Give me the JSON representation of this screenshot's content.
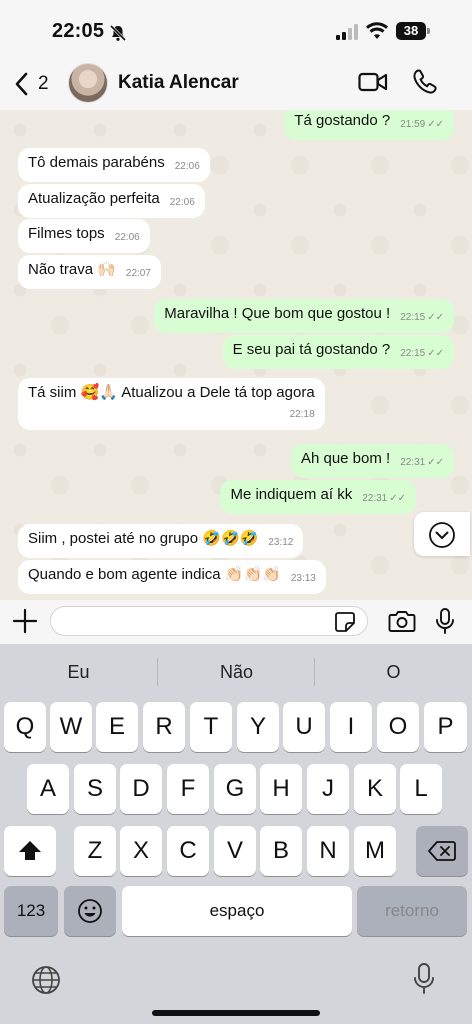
{
  "status_bar": {
    "time": "22:05",
    "battery": "38"
  },
  "header": {
    "back_count": "2",
    "contact_name": "Katia Alencar"
  },
  "messages": [
    {
      "dir": "out",
      "text": "Tá gostando ?",
      "time": "21:59"
    },
    {
      "dir": "in",
      "text": "Tô demais parabéns",
      "time": "22:06"
    },
    {
      "dir": "in",
      "text": "Atualização perfeita",
      "time": "22:06"
    },
    {
      "dir": "in",
      "text": "Filmes tops",
      "time": "22:06"
    },
    {
      "dir": "in",
      "text": "Não trava 🙌🏻",
      "time": "22:07"
    },
    {
      "dir": "out",
      "text": "Maravilha ! Que bom que gostou !",
      "time": "22:15"
    },
    {
      "dir": "out",
      "text": "E seu pai tá gostando ?",
      "time": "22:15"
    },
    {
      "dir": "in",
      "text": "Tá siim 🥰🙏🏻 Atualizou a Dele tá top agora",
      "time": "22:18"
    },
    {
      "dir": "out",
      "text": "Ah que bom !",
      "time": "22:31"
    },
    {
      "dir": "out",
      "text": "Me indiquem aí kk",
      "time": "22:31"
    },
    {
      "dir": "in",
      "text": "Siim , postei até no grupo 🤣🤣🤣",
      "time": "23:12"
    },
    {
      "dir": "in",
      "text": "Quando e bom agente indica 👏🏻👏🏻👏🏻",
      "time": "23:13"
    }
  ],
  "composer": {
    "placeholder": ""
  },
  "keyboard": {
    "suggestions": [
      "Eu",
      "Não",
      "O"
    ],
    "row1": [
      "Q",
      "W",
      "E",
      "R",
      "T",
      "Y",
      "U",
      "I",
      "O",
      "P"
    ],
    "row2": [
      "A",
      "S",
      "D",
      "F",
      "G",
      "H",
      "J",
      "K",
      "L"
    ],
    "row3": [
      "Z",
      "X",
      "C",
      "V",
      "B",
      "N",
      "M"
    ],
    "numbers_key": "123",
    "space_key": "espaço",
    "return_key": "retorno"
  },
  "colors": {
    "incoming": "#ffffff",
    "outgoing": "#d9fdd3",
    "chat_bg": "#efeae2"
  }
}
